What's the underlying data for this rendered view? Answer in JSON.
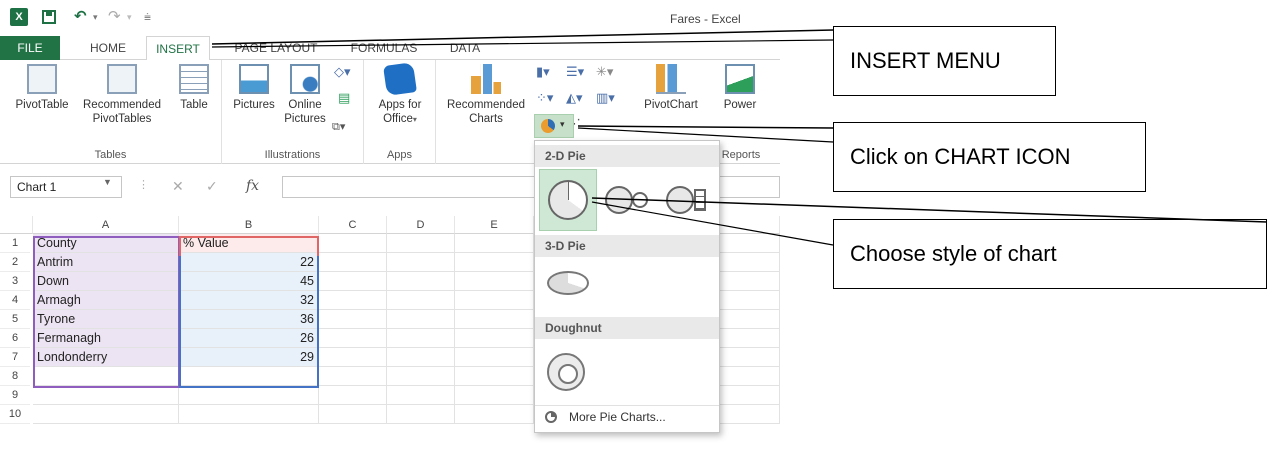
{
  "app": {
    "logo": "X",
    "window_title": "Fares - Excel"
  },
  "tabs": [
    {
      "label": "FILE"
    },
    {
      "label": "HOME"
    },
    {
      "label": "INSERT"
    },
    {
      "label": "PAGE LAYOUT"
    },
    {
      "label": "FORMULAS"
    },
    {
      "label": "DATA"
    }
  ],
  "ribbon": {
    "groups": {
      "tables": "Tables",
      "illustrations": "Illustrations",
      "apps": "Apps",
      "reports": "Reports"
    },
    "buttons": {
      "pivottable": "PivotTable",
      "recommended_pivottables_1": "Recommended",
      "recommended_pivottables_2": "PivotTables",
      "table": "Table",
      "pictures": "Pictures",
      "online_pictures_1": "Online",
      "online_pictures_2": "Pictures",
      "apps_for_office_1": "Apps for",
      "apps_for_office_2": "Office",
      "recommended_charts_1": "Recommended",
      "recommended_charts_2": "Charts",
      "pivotchart": "PivotChart",
      "power": "Power"
    }
  },
  "formula_bar": {
    "name_box": "Chart 1",
    "fx": "fx",
    "value": ""
  },
  "sheet": {
    "columns": [
      "A",
      "B",
      "C",
      "D",
      "E"
    ],
    "rows": [
      "1",
      "2",
      "3",
      "4",
      "5",
      "6",
      "7",
      "8",
      "9",
      "10"
    ],
    "header": {
      "county": "County",
      "value": "% Value"
    },
    "data": [
      {
        "county": "Antrim",
        "value": "22"
      },
      {
        "county": "Down",
        "value": "45"
      },
      {
        "county": "Armagh",
        "value": "32"
      },
      {
        "county": "Tyrone",
        "value": "36"
      },
      {
        "county": "Fermanagh",
        "value": "26"
      },
      {
        "county": "Londonderry",
        "value": "29"
      }
    ]
  },
  "pie_menu": {
    "section_2d": "2-D Pie",
    "section_3d": "3-D Pie",
    "section_doughnut": "Doughnut",
    "more_label": "More Pie Charts..."
  },
  "annotations": {
    "insert_menu": "INSERT MENU",
    "chart_icon": "Click on CHART ICON",
    "chart_style": "Choose style of chart"
  },
  "colors": {
    "excel_green": "#217346",
    "selection_purple": "#8e5dbd",
    "selection_blue": "#4472c4",
    "pie_highlight": "#c6e0c9"
  }
}
